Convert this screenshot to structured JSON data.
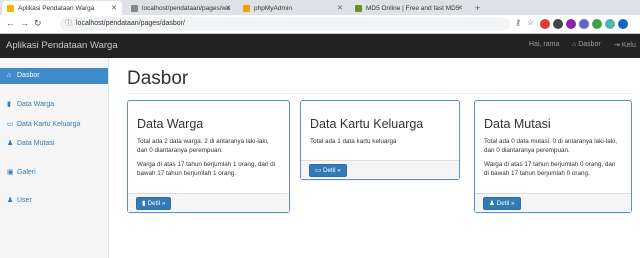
{
  "browser": {
    "tabs": [
      {
        "title": "Aplikasi Pendataan Warga",
        "active": true,
        "color": "#f4b400"
      },
      {
        "title": "localhost/pendataan/pages/wa",
        "active": false,
        "color": "#888888"
      },
      {
        "title": "phpMyAdmin",
        "active": false,
        "color": "#f39c12"
      },
      {
        "title": "MD5 Online | Free and fast MD5",
        "active": false,
        "color": "#6b8e23"
      }
    ],
    "url": "localhost/pendataan/pages/dasbor/"
  },
  "app": {
    "brand": "Aplikasi Pendataan Warga",
    "greeting": "Hai, rama",
    "nav": {
      "dasbor": "Dasbor",
      "keluar": "Kelu"
    }
  },
  "sidebar": {
    "items": [
      {
        "label": "Dasbor",
        "icon": "home-icon",
        "active": true
      },
      {
        "label": "Data Warga",
        "icon": "book-icon",
        "active": false
      },
      {
        "label": "Data Kartu Keluarga",
        "icon": "inbox-icon",
        "active": false
      },
      {
        "label": "Data Mutasi",
        "icon": "user-move-icon",
        "active": false
      },
      {
        "label": "Galeri",
        "icon": "image-icon",
        "active": false
      },
      {
        "label": "User",
        "icon": "user-icon",
        "active": false
      }
    ]
  },
  "main": {
    "title": "Dasbor",
    "panels": [
      {
        "heading": "Data Warga",
        "lines": [
          "Total ada 2 data warga. 2 di antaranya laki-laki, dan 0 diantaranya perempuan.",
          "Warga di atas 17 tahun berjumlah 1 orang, dan di bawah 17 tahun berjumlah 1 orang."
        ],
        "button": "Detil »",
        "button_icon": "book-icon"
      },
      {
        "heading": "Data Kartu Keluarga",
        "lines": [
          "Total ada 1 data kartu keluarga"
        ],
        "button": "Detil »",
        "button_icon": "inbox-icon"
      },
      {
        "heading": "Data Mutasi",
        "lines": [
          "Total ada 0 data mutasi. 0 di antaranya laki-laki, dan 0 diantaranya perempuan.",
          "Warga di atas 17 tahun berjumlah 0 orang, dan di bawah 17 tahun berjumlah 0 orang."
        ],
        "button": "Detil »",
        "button_icon": "user-move-icon"
      }
    ]
  },
  "colors": {
    "navbar": "#222222",
    "sidebar_active": "#428bca",
    "link": "#337ab7",
    "panel_border": "#5b8fd1",
    "button": "#337ab7"
  }
}
